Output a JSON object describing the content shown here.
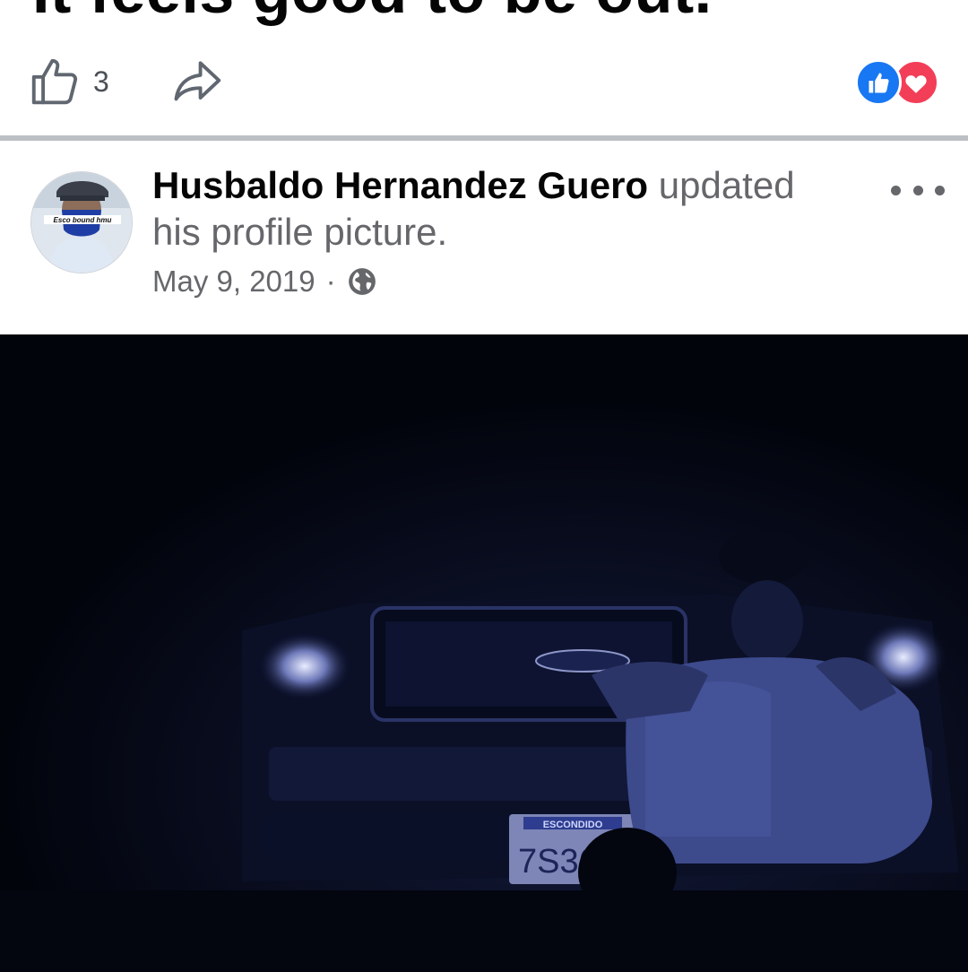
{
  "previous_post": {
    "caption": "It feels good to be out.",
    "like_count": "3",
    "reactions": [
      "like-icon",
      "love-icon"
    ]
  },
  "post": {
    "author": "Husbaldo Hernandez Guero",
    "action_text": " updated his profile picture.",
    "date": "May 9, 2019",
    "separator": "·",
    "privacy_icon": "globe-icon",
    "avatar_caption": "Esco bound hmu",
    "photo_plate_top": "ESCONDIDO",
    "photo_plate_number": "7S36"
  },
  "colors": {
    "like_blue": "#1877f2",
    "love_red": "#f33e58",
    "text_primary": "#050505",
    "text_secondary": "#65676b"
  }
}
